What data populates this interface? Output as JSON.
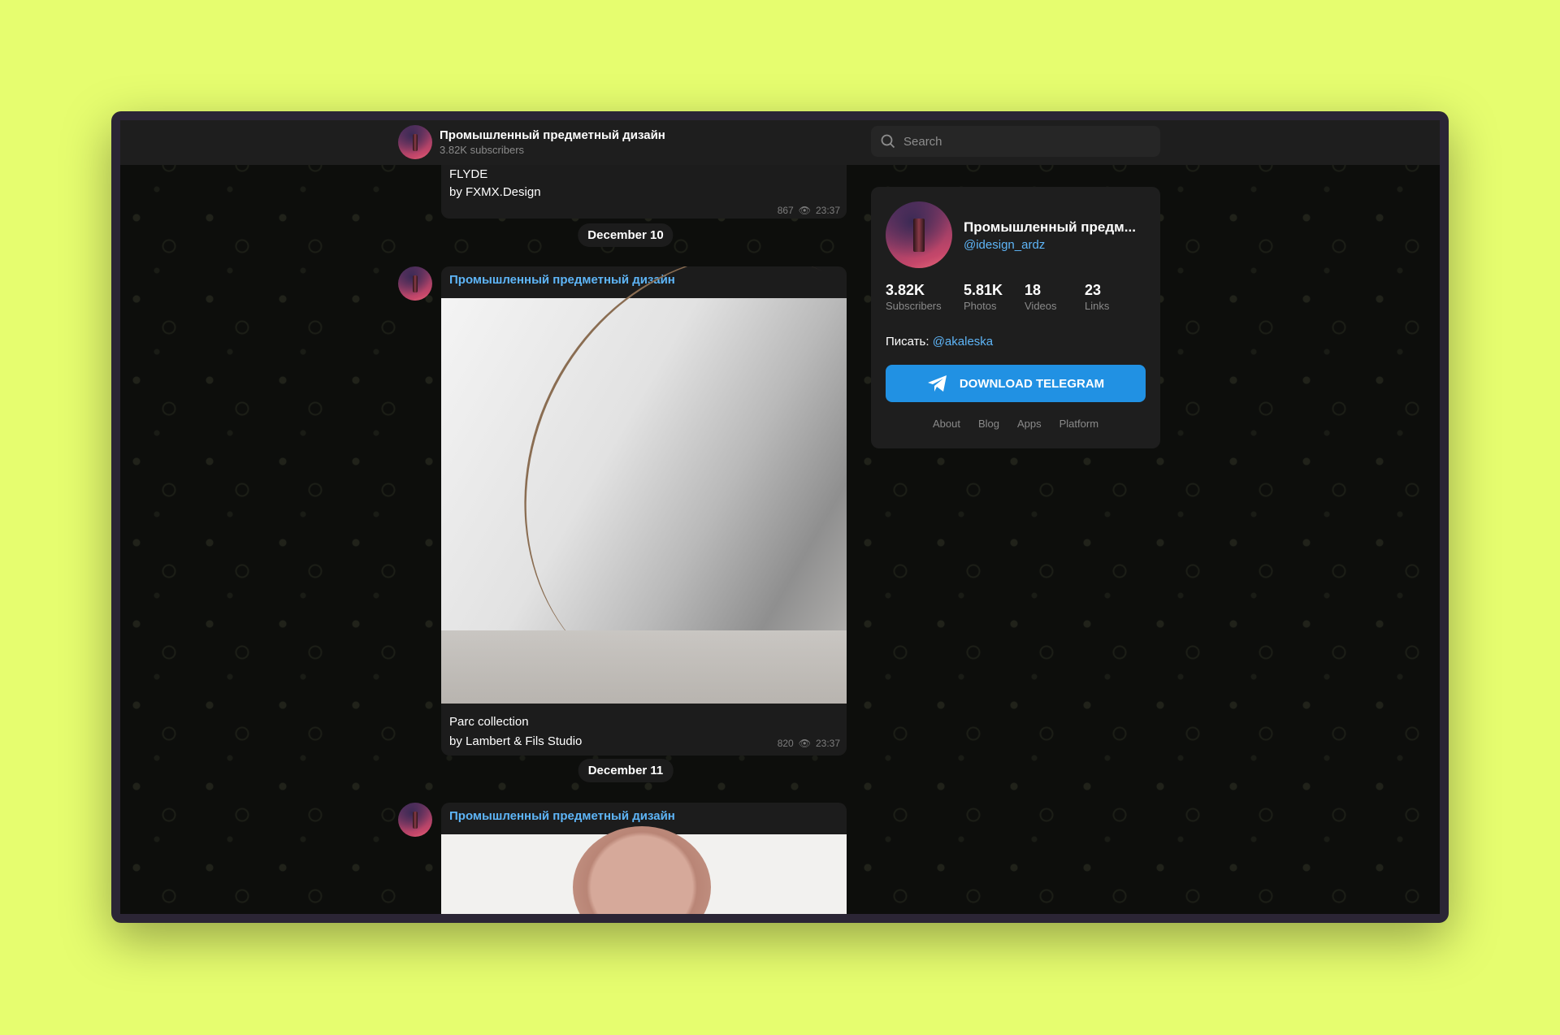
{
  "header": {
    "title": "Промышленный предметный дизайн",
    "subtitle": "3.82K subscribers",
    "search_placeholder": "Search"
  },
  "messages": [
    {
      "lines": [
        "FLYDE",
        "by FXMX.Design"
      ],
      "views": "867",
      "time": "23:37"
    },
    {
      "author": "Промышленный предметный дизайн",
      "lines": [
        "Parc collection",
        "by Lambert & Fils Studio"
      ],
      "views": "820",
      "time": "23:37"
    },
    {
      "author": "Промышленный предметный дизайн"
    }
  ],
  "dates": [
    "December 10",
    "December 11"
  ],
  "panel": {
    "title": "Промышленный предм...",
    "handle": "@idesign_ardz",
    "stats": [
      {
        "value": "3.82K",
        "label": "Subscribers"
      },
      {
        "value": "5.81K",
        "label": "Photos"
      },
      {
        "value": "18",
        "label": "Videos"
      },
      {
        "value": "23",
        "label": "Links"
      }
    ],
    "contact_label": "Писать:",
    "contact_handle": "@akaleska",
    "download": "DOWNLOAD TELEGRAM",
    "links": [
      "About",
      "Blog",
      "Apps",
      "Platform"
    ]
  },
  "colors": {
    "accent": "#2191e3",
    "link": "#5eb5f7",
    "background": "#e6fd6f"
  }
}
